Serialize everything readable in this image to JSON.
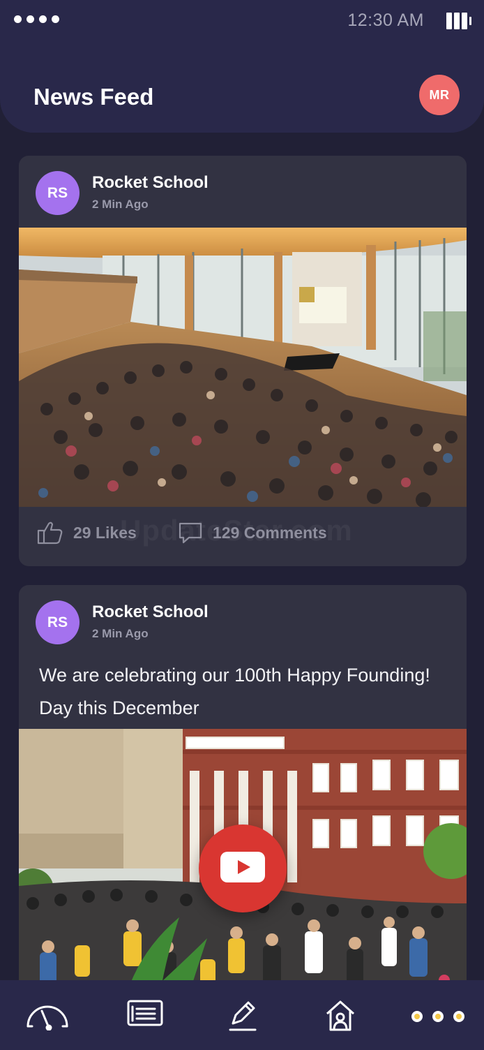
{
  "status_bar": {
    "time": "12:30 AM",
    "signal_icon": "signal-dots-icon",
    "battery_icon": "battery-icon"
  },
  "header": {
    "title": "News Feed",
    "avatar_initials": "MR",
    "avatar_color": "#ef6b6b"
  },
  "posts": [
    {
      "avatar_initials": "RS",
      "avatar_color": "#a472ee",
      "author": "Rocket School",
      "time": "2 Min Ago",
      "image": "auditorium-photo",
      "likes_label": "29 Likes",
      "comments_label": "129 Comments",
      "watermark": "UpdateStar.com"
    },
    {
      "avatar_initials": "RS",
      "avatar_color": "#a472ee",
      "author": "Rocket School",
      "time": "2 Min Ago",
      "text": "We are celebrating our 100th Happy Founding! Day this December",
      "image": "campus-video-thumbnail",
      "play_icon": "youtube-play-icon"
    }
  ],
  "bottom_nav": {
    "items": [
      {
        "icon": "dashboard-gauge-icon"
      },
      {
        "icon": "news-list-icon"
      },
      {
        "icon": "edit-pencil-icon"
      },
      {
        "icon": "home-icon"
      },
      {
        "icon": "more-dots-icon"
      }
    ]
  },
  "colors": {
    "background": "#212036",
    "header": "#29284a",
    "card": "#323242",
    "muted_text": "#9a9aab",
    "play_button": "#d93631"
  }
}
